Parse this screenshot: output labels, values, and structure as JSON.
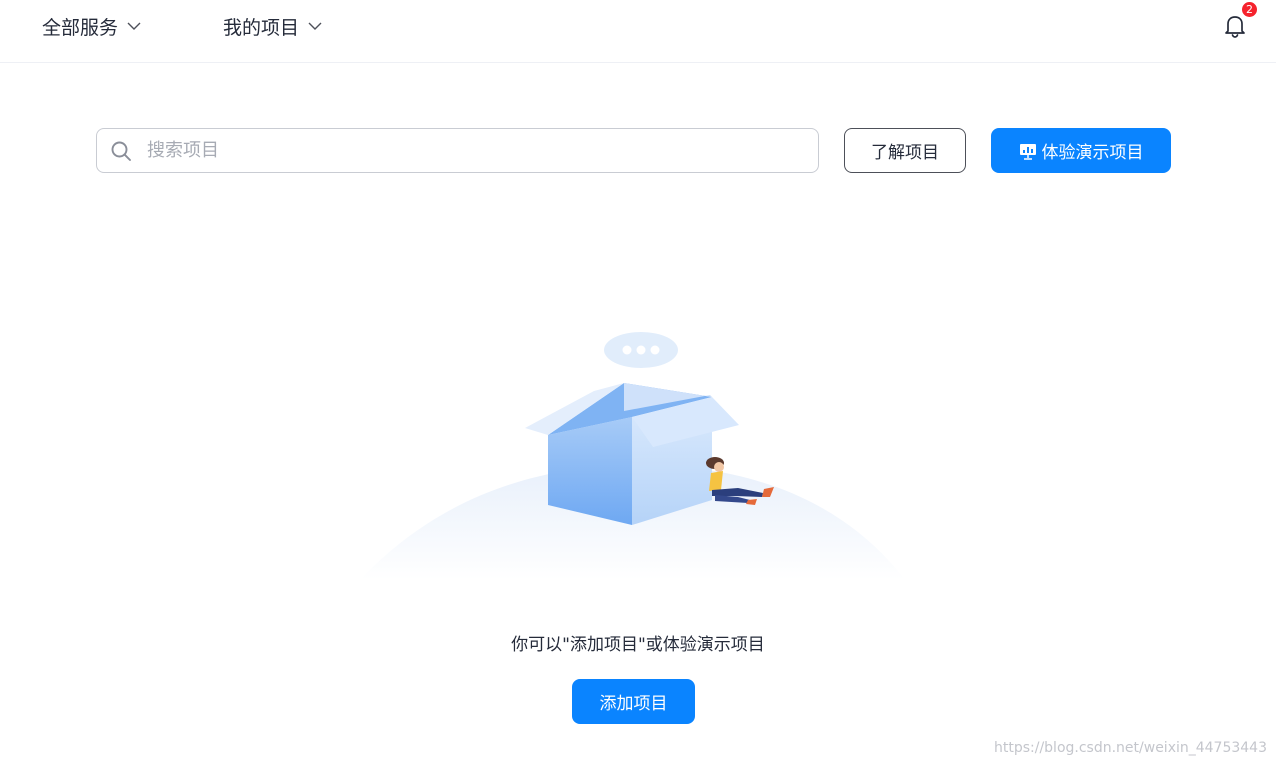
{
  "header": {
    "menus": [
      {
        "label": "全部服务"
      },
      {
        "label": "我的项目"
      }
    ],
    "notifications": {
      "count": "2",
      "icon": "bell-icon"
    }
  },
  "search": {
    "placeholder": "搜索项目",
    "value": "",
    "icon": "search-icon"
  },
  "actions": {
    "learn_label": "了解项目",
    "demo_label": "体验演示项目",
    "demo_icon": "presentation-icon"
  },
  "empty_state": {
    "illustration": "open-box-with-person-illustration",
    "message": "你可以\"添加项目\"或体验演示项目",
    "add_label": "添加项目"
  },
  "watermark": "https://blog.csdn.net/weixin_44753443",
  "colors": {
    "primary": "#0a84ff",
    "badge": "#f5222d",
    "text": "#252b3a"
  }
}
